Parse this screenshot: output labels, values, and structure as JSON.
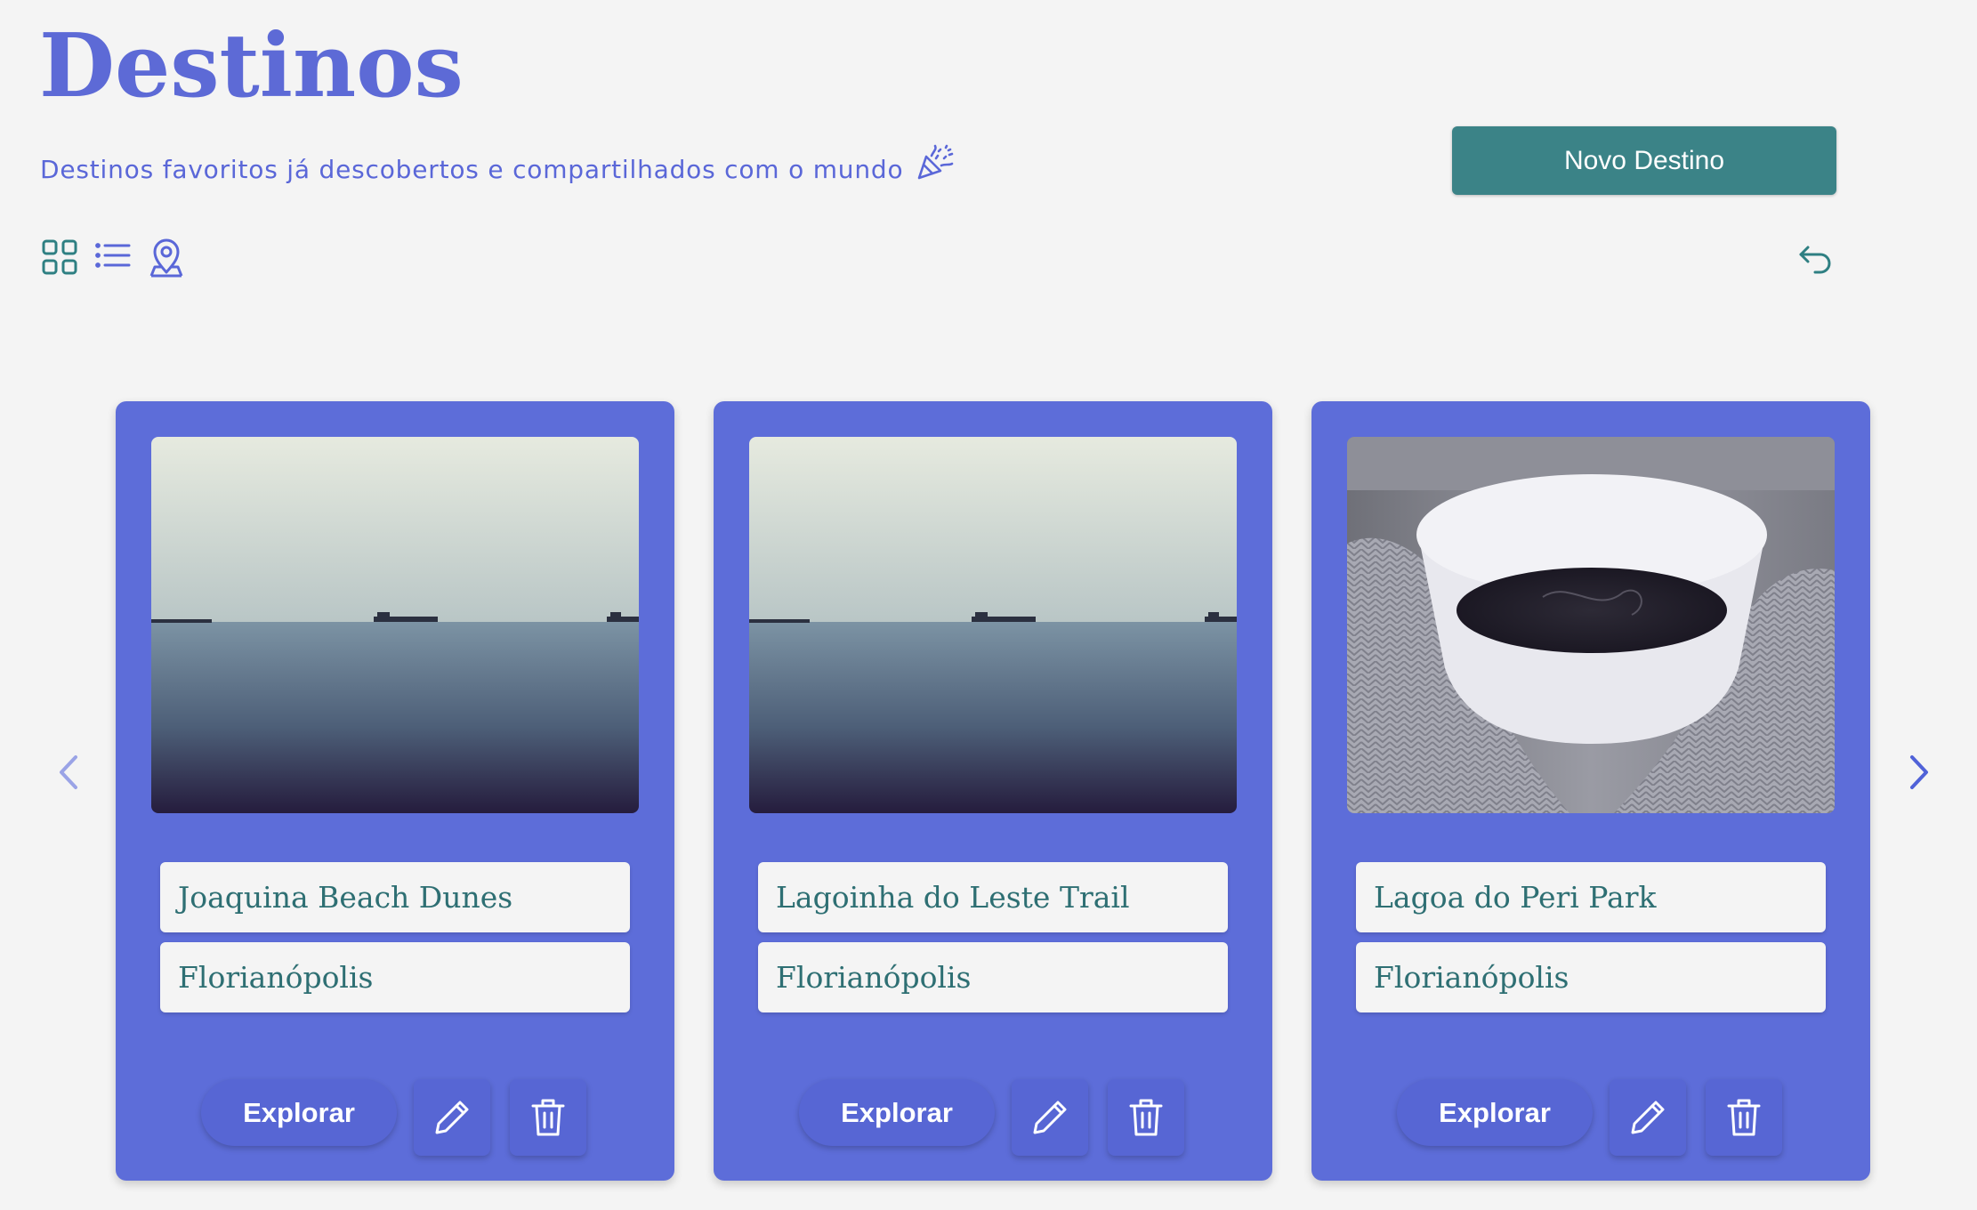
{
  "header": {
    "title": "Destinos",
    "subtitle": "Destinos favoritos já descobertos e compartilhados com o mundo",
    "subtitle_icon": "party-popper-icon",
    "new_button": "Novo Destino"
  },
  "toolbar": {
    "views": [
      "grid-view-icon",
      "list-view-icon",
      "map-pin-user-icon"
    ],
    "undo_icon": "undo-icon"
  },
  "carousel": {
    "prev_icon": "chevron-left-icon",
    "next_icon": "chevron-right-icon",
    "cards": [
      {
        "name": "Joaquina Beach Dunes",
        "city": "Florianópolis",
        "explore_label": "Explorar",
        "image": "sea-horizon-ships"
      },
      {
        "name": "Lagoinha do Leste Trail",
        "city": "Florianópolis",
        "explore_label": "Explorar",
        "image": "sea-horizon-ships"
      },
      {
        "name": "Lagoa do Peri Park",
        "city": "Florianópolis",
        "explore_label": "Explorar",
        "image": "coffee-cup-knit-mittens"
      }
    ]
  },
  "colors": {
    "primary": "#5d6ad6",
    "card": "#5d6dd9",
    "accent_teal": "#3b8387",
    "background": "#f4f4f4"
  }
}
